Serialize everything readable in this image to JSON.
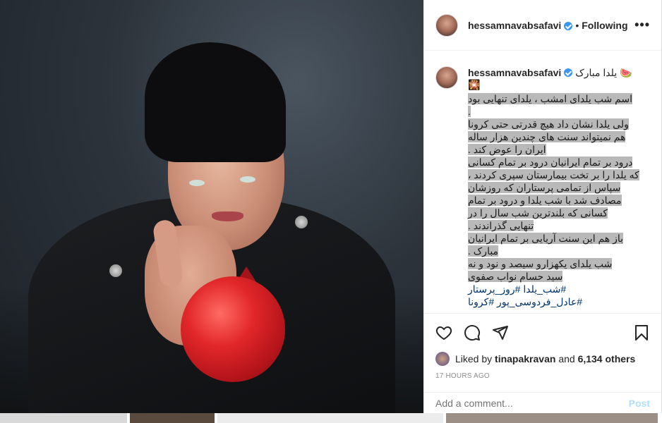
{
  "header": {
    "username": "hessamnavabsafavi",
    "separator": "•",
    "follow_status": "Following",
    "more_label": "•••"
  },
  "caption": {
    "username": "hessamnavabsafavi",
    "title": "یلدا مبارک",
    "title_emoji": "🍉",
    "emoji_line": "🎇",
    "lines": [
      "اسم شب یلدای امشب ، یلدای تنهایی بود",
      ".",
      "ولی یلدا نشان داد هیچ قدرتی حتی کرونا",
      "هم نمیتواند سنت های چندین هزار ساله",
      "ایران را عوض کند .",
      "درود بر تمام ایرانیان درود بر تمام کسانی",
      "که یلدا را بر تخت بیمارستان سپری کردند ،",
      "سپاس از تمامی پرستاران که روزشان",
      "مصادف شد با شب یلدا و درود بر تمام",
      "کسانی که بلندترین شب سال را در",
      "تنهایی گذراندند .",
      "باز هم این سنت آریایی بر تمام ایرانیان",
      "مبارک .",
      "شب یلدای یکهزارو سیصد و نود و نه",
      "سید حسام نواب صفوی"
    ],
    "hashtags_1": "#شب_یلدا #روز_پرستار",
    "hashtags_2": "#عادل_فردوسی_پور #کرونا"
  },
  "likes": {
    "prefix": "Liked by",
    "user": "tinapakravan",
    "conjunction": "and",
    "others": "6,134 others"
  },
  "timestamp": "17 HOURS AGO",
  "comment": {
    "placeholder": "Add a comment...",
    "post_label": "Post"
  },
  "icons": {
    "like": "heart-icon",
    "comment": "comment-icon",
    "share": "share-icon",
    "save": "bookmark-icon"
  },
  "colors": {
    "verified": "#3897f0",
    "post_disabled": "#b2dffc",
    "hashtag": "#003569",
    "highlight": "#b9b9b9"
  }
}
